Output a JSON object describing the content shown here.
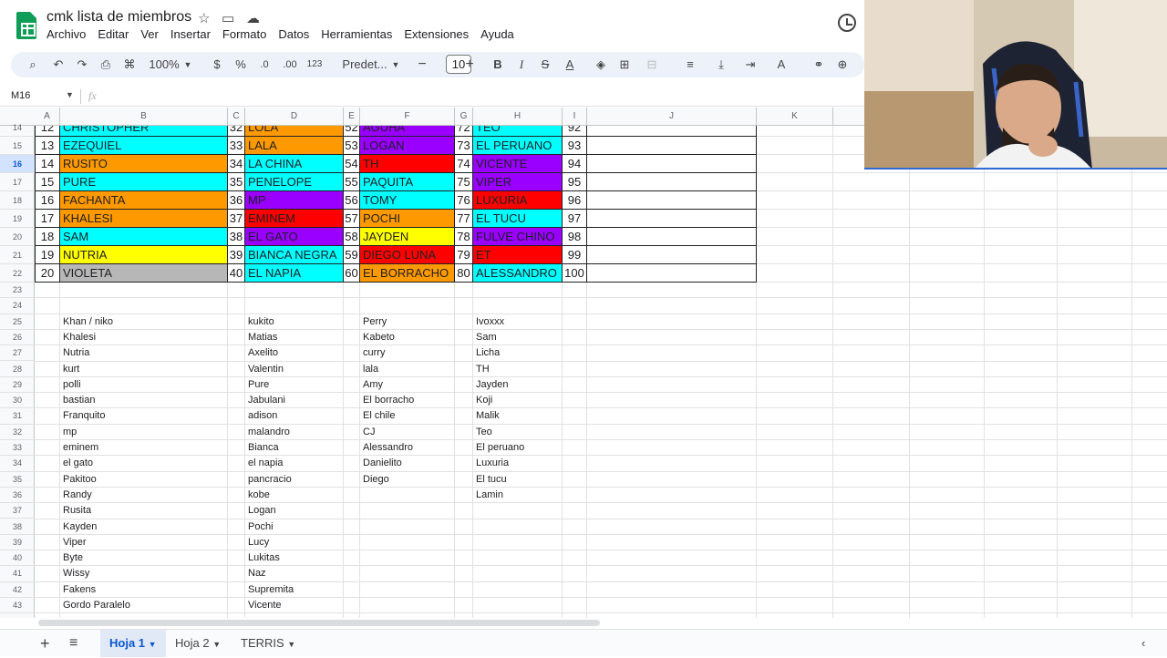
{
  "doc": {
    "title": "cmk lista de miembros"
  },
  "menu": [
    "Archivo",
    "Editar",
    "Ver",
    "Insertar",
    "Formato",
    "Datos",
    "Herramientas",
    "Extensiones",
    "Ayuda"
  ],
  "toolbar": {
    "zoom": "100%",
    "currency": "$",
    "percent": "%",
    "dec_less": ".0",
    "dec_more": ".00",
    "number_format": "123",
    "font": "Predet...",
    "font_size": "10"
  },
  "formula": {
    "name_box": "M16",
    "fx": "fx"
  },
  "columns": [
    "A",
    "B",
    "C",
    "D",
    "E",
    "F",
    "G",
    "H",
    "I",
    "J",
    "K"
  ],
  "rows": [
    "14",
    "15",
    "16",
    "17",
    "18",
    "19",
    "20",
    "21",
    "22",
    "23",
    "24",
    "25",
    "26",
    "27",
    "28",
    "29",
    "30",
    "31",
    "32",
    "33",
    "34",
    "35",
    "36",
    "37",
    "38",
    "39",
    "40",
    "41",
    "42",
    "43"
  ],
  "selected_row": "16",
  "table": [
    {
      "cells": [
        [
          "12",
          "CHRISTOPHER"
        ],
        [
          "32",
          "LOLA"
        ],
        [
          "52",
          "AGUHA"
        ],
        [
          "72",
          "TEO"
        ],
        [
          "92",
          ""
        ]
      ]
    },
    {
      "cells": [
        [
          "13",
          "EZEQUIEL"
        ],
        [
          "33",
          "LALA"
        ],
        [
          "53",
          "LOGAN"
        ],
        [
          "73",
          "EL PERUANO"
        ],
        [
          "93",
          ""
        ]
      ]
    },
    {
      "cells": [
        [
          "14",
          "RUSITO"
        ],
        [
          "34",
          "LA CHINA"
        ],
        [
          "54",
          "TH"
        ],
        [
          "74",
          "VICENTE"
        ],
        [
          "94",
          ""
        ]
      ]
    },
    {
      "cells": [
        [
          "15",
          "PURE"
        ],
        [
          "35",
          "PENELOPE"
        ],
        [
          "55",
          "PAQUITA"
        ],
        [
          "75",
          "VIPER"
        ],
        [
          "95",
          ""
        ]
      ]
    },
    {
      "cells": [
        [
          "16",
          "FACHANTA"
        ],
        [
          "36",
          "MP"
        ],
        [
          "56",
          "TOMY"
        ],
        [
          "76",
          "LUXURIA"
        ],
        [
          "96",
          ""
        ]
      ]
    },
    {
      "cells": [
        [
          "17",
          "KHALESI"
        ],
        [
          "37",
          "EMINEM"
        ],
        [
          "57",
          "POCHI"
        ],
        [
          "77",
          "EL TUCU"
        ],
        [
          "97",
          ""
        ]
      ]
    },
    {
      "cells": [
        [
          "18",
          "SAM"
        ],
        [
          "38",
          "EL GATO"
        ],
        [
          "58",
          "JAYDEN"
        ],
        [
          "78",
          "FULVE CHINO"
        ],
        [
          "98",
          ""
        ]
      ]
    },
    {
      "cells": [
        [
          "19",
          "NUTRIA"
        ],
        [
          "39",
          "BIANCA NEGRA"
        ],
        [
          "59",
          "DIEGO LUNA"
        ],
        [
          "79",
          "ET"
        ],
        [
          "99",
          ""
        ]
      ]
    },
    {
      "cells": [
        [
          "20",
          "VIOLETA"
        ],
        [
          "40",
          "EL NAPIA"
        ],
        [
          "60",
          "EL BORRACHO"
        ],
        [
          "80",
          "ALESSANDRO"
        ],
        [
          "100",
          ""
        ]
      ]
    }
  ],
  "colors": {
    "cyan": "#00ffff",
    "orange": "#ff9900",
    "purple": "#9900ff",
    "red": "#ff0000",
    "yellow": "#ffff00",
    "gray": "#b7b7b7",
    "accent": "#0b57d0",
    "sheets_green": "#0f9d58"
  },
  "table_colors": [
    [
      "cyan",
      "orange",
      "purple",
      "cyan"
    ],
    [
      "cyan",
      "orange",
      "purple",
      "cyan"
    ],
    [
      "orange",
      "cyan",
      "red",
      "purple"
    ],
    [
      "cyan",
      "cyan",
      "cyan",
      "purple"
    ],
    [
      "orange",
      "purple",
      "cyan",
      "red"
    ],
    [
      "orange",
      "red",
      "orange",
      "cyan"
    ],
    [
      "cyan",
      "purple",
      "yellow",
      "purple"
    ],
    [
      "yellow",
      "cyan",
      "red",
      "red"
    ],
    [
      "gray",
      "cyan",
      "orange",
      "cyan"
    ]
  ],
  "lists": {
    "B": [
      "Khan / niko",
      "Khalesi",
      "Nutria",
      "kurt",
      "polli",
      "bastian",
      "Franquito",
      "mp",
      "eminem",
      "el gato",
      "Pakitoo",
      "Randy",
      "Rusita",
      "Kayden",
      "Viper",
      "Byte",
      "Wissy",
      "Fakens",
      "Gordo Paralelo"
    ],
    "D": [
      "kukito",
      "Matias",
      "Axelito",
      "Valentin",
      "Pure",
      "Jabulani",
      "adison",
      "malandro",
      "Bianca",
      "el napia",
      "pancracio",
      "kobe",
      "Logan",
      "Pochi",
      "Lucy",
      "Lukitas",
      "Naz",
      "Supremita",
      "Vicente"
    ],
    "F": [
      "Perry",
      "Kabeto",
      "curry",
      "lala",
      "Amy",
      "El borracho",
      "El chile",
      "CJ",
      "Alessandro",
      "Danielito",
      "Diego"
    ],
    "H": [
      "Ivoxxx",
      "Sam",
      "Licha",
      "TH",
      "Jayden",
      "Koji",
      "Malik",
      "Teo",
      "El peruano",
      "Luxuria",
      "El tucu",
      "Lamin"
    ]
  },
  "sheets": [
    "Hoja 1",
    "Hoja 2",
    "TERRIS"
  ],
  "active_sheet": "Hoja 1"
}
